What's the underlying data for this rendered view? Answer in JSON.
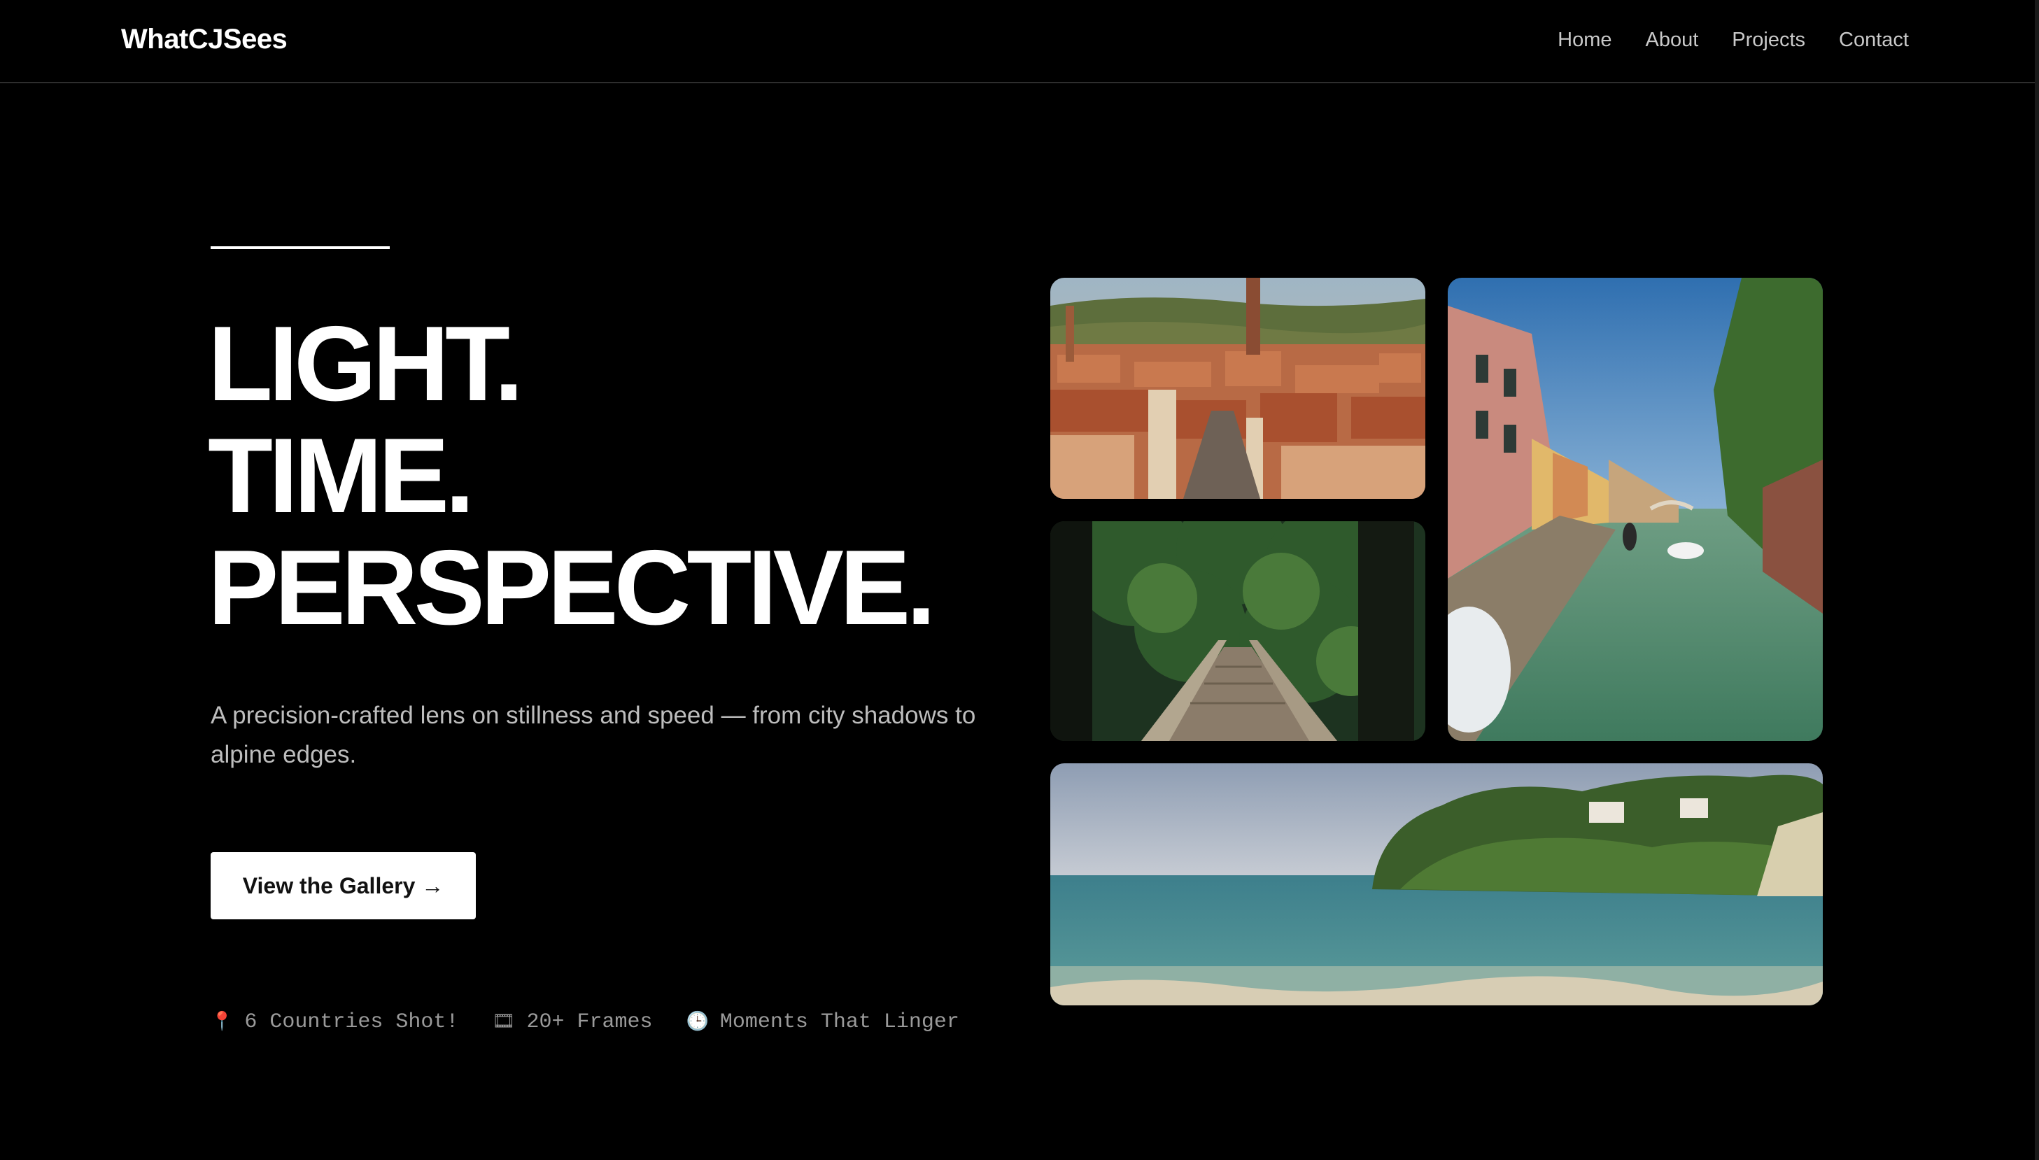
{
  "header": {
    "brand": "WhatCJSees",
    "nav": [
      "Home",
      "About",
      "Projects",
      "Contact"
    ]
  },
  "hero": {
    "headline": [
      "LIGHT.",
      "TIME.",
      "PERSPECTIVE."
    ],
    "tagline": "A precision-crafted lens on stillness and speed — from city shadows to alpine edges.",
    "cta_label": "View the Gallery →"
  },
  "stats": [
    {
      "icon": "📍",
      "icon_name": "map-pin-icon",
      "label": "6 Countries Shot!"
    },
    {
      "icon": "🎞",
      "icon_name": "film-frames-icon",
      "label": "20+ Frames"
    },
    {
      "icon": "🕒",
      "icon_name": "clock-icon",
      "label": "Moments That Linger"
    }
  ],
  "gallery": [
    {
      "name": "photo-old-town-rooftops"
    },
    {
      "name": "photo-forest-footbridge"
    },
    {
      "name": "photo-venice-canal"
    },
    {
      "name": "photo-tropical-beach-cliff"
    }
  ],
  "colors": {
    "background": "#000000",
    "text_primary": "#ffffff",
    "text_muted": "#bdbdbd",
    "stat_text": "#9a9a9a",
    "divider": "#2e2e2e",
    "cta_bg": "#ffffff",
    "cta_text": "#111111"
  }
}
